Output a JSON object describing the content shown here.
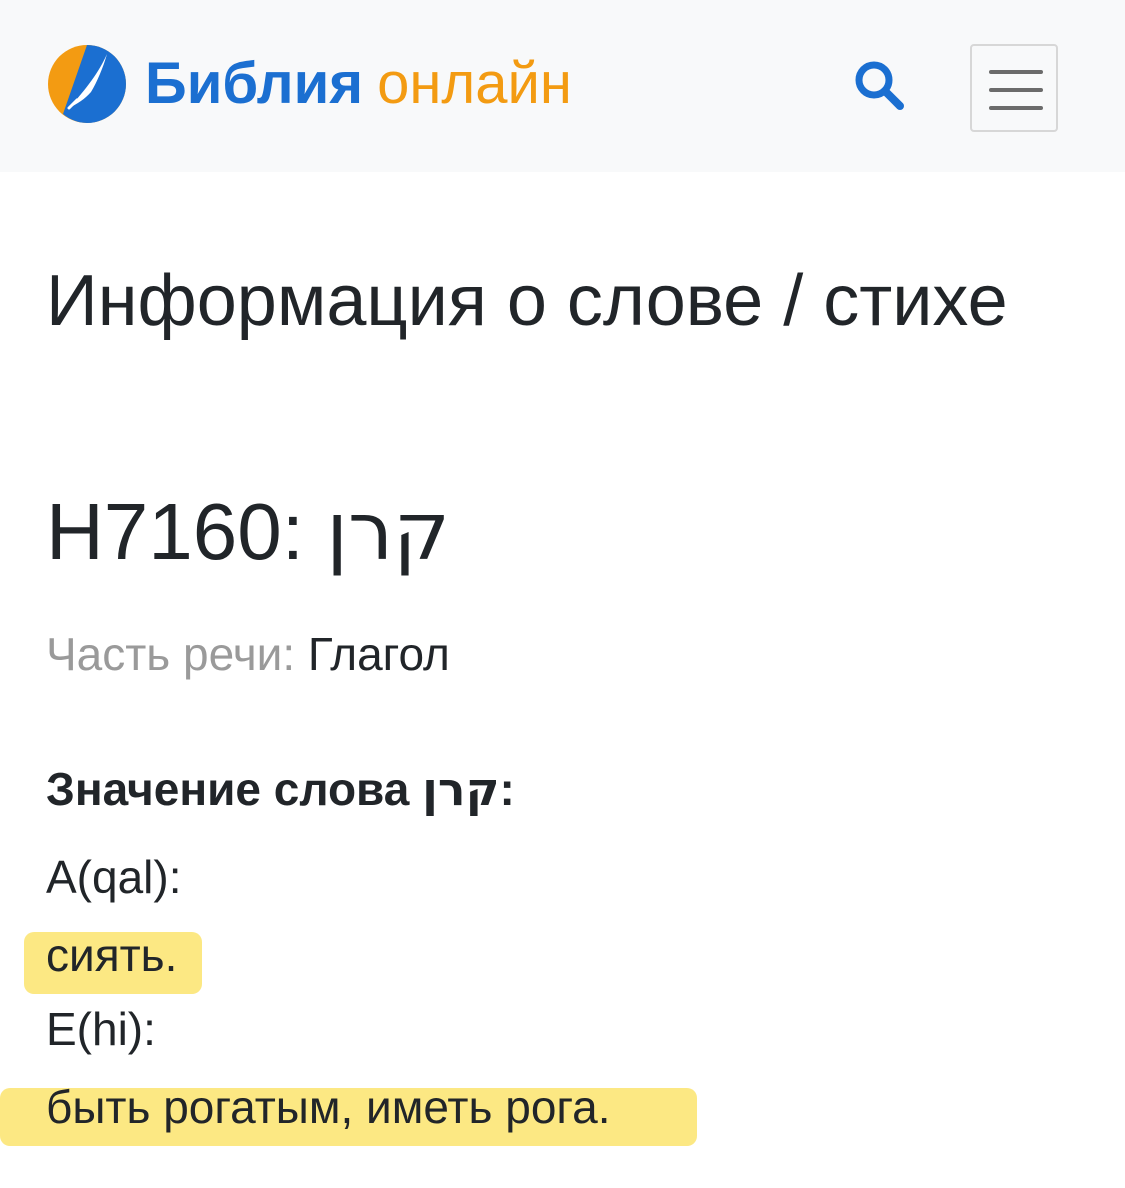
{
  "navbar": {
    "brand_main": "Библия",
    "brand_sub": "онлайн",
    "logo_icon": "quill-logo-icon",
    "search_icon": "search-icon",
    "menu_icon": "hamburger-menu-icon",
    "colors": {
      "brand_main": "#1b6fd1",
      "brand_sub": "#f39b12",
      "background": "#f8f9fa"
    }
  },
  "main": {
    "page_title": "Информация о слове / стихе",
    "word_code": "H7160:",
    "word_hebrew": "קרן",
    "part_of_speech_label": "Часть речи:",
    "part_of_speech_value": "Глагол",
    "meaning_label": "Значение слова",
    "meaning_word": "קרן",
    "meaning_colon": ":",
    "meanings": [
      {
        "stem": "A(qal):",
        "text": "сиять."
      },
      {
        "stem": "E(hi):",
        "text": "быть рогатым, иметь рога."
      }
    ],
    "highlight_color": "#fbe05a"
  }
}
